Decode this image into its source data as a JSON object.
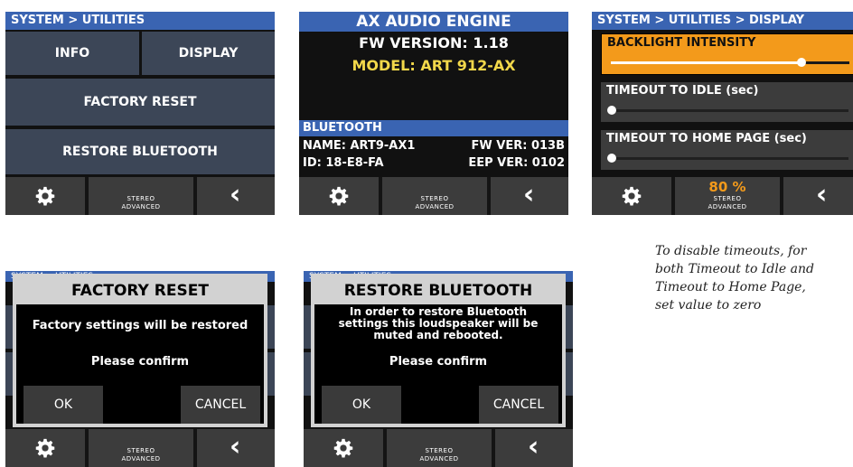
{
  "screen_utilities": {
    "header": "SYSTEM > UTILITIES",
    "info_button": "INFO",
    "display_button": "DISPLAY",
    "factory_reset_button": "FACTORY RESET",
    "restore_bluetooth_button": "RESTORE BLUETOOTH",
    "stereo_line1": "STEREO",
    "stereo_line2": "ADVANCED"
  },
  "screen_engine": {
    "title": "AX AUDIO ENGINE",
    "fw_version": "FW VERSION: 1.18",
    "model": "MODEL: ART 912-AX",
    "bluetooth_header": "BLUETOOTH",
    "bt_name": "NAME: ART9-AX1",
    "bt_fw": "FW VER: 013B",
    "bt_id": "ID: 18-E8-FA",
    "bt_eep": "EEP VER: 0102",
    "stereo_line1": "STEREO",
    "stereo_line2": "ADVANCED"
  },
  "screen_display": {
    "header": "SYSTEM > UTILITIES > DISPLAY",
    "backlight_label": "BACKLIGHT INTENSITY",
    "backlight_level": 0.8,
    "timeout_idle_label": "TIMEOUT TO IDLE (sec)",
    "timeout_idle_level": 0,
    "timeout_home_label": "TIMEOUT TO HOME PAGE (sec)",
    "timeout_home_level": 0,
    "value_readout": "80 %",
    "stereo_line1": "STEREO",
    "stereo_line2": "ADVANCED"
  },
  "dialog_factory_reset": {
    "header_ghost": "SYSTEM > UTILITIES",
    "title": "FACTORY RESET",
    "message": "Factory settings will be restored",
    "confirm": "Please confirm",
    "ok": "OK",
    "cancel": "CANCEL",
    "stereo_line1": "STEREO",
    "stereo_line2": "ADVANCED"
  },
  "dialog_restore_bluetooth": {
    "header_ghost": "SYSTEM > UTILITIES",
    "title": "RESTORE BLUETOOTH",
    "message": "In order to restore Bluetooth\nsettings this loudspeaker will be\nmuted and rebooted.",
    "confirm": "Please confirm",
    "ok": "OK",
    "cancel": "CANCEL",
    "stereo_line1": "STEREO",
    "stereo_line2": "ADVANCED"
  },
  "caption": "To disable timeouts, for\nboth Timeout to Idle and\nTimeout to Home Page,\nset value to zero",
  "colors": {
    "header_blue": "#3a64b2",
    "accent_orange": "#f39a1b",
    "model_yellow": "#f2d84a"
  }
}
